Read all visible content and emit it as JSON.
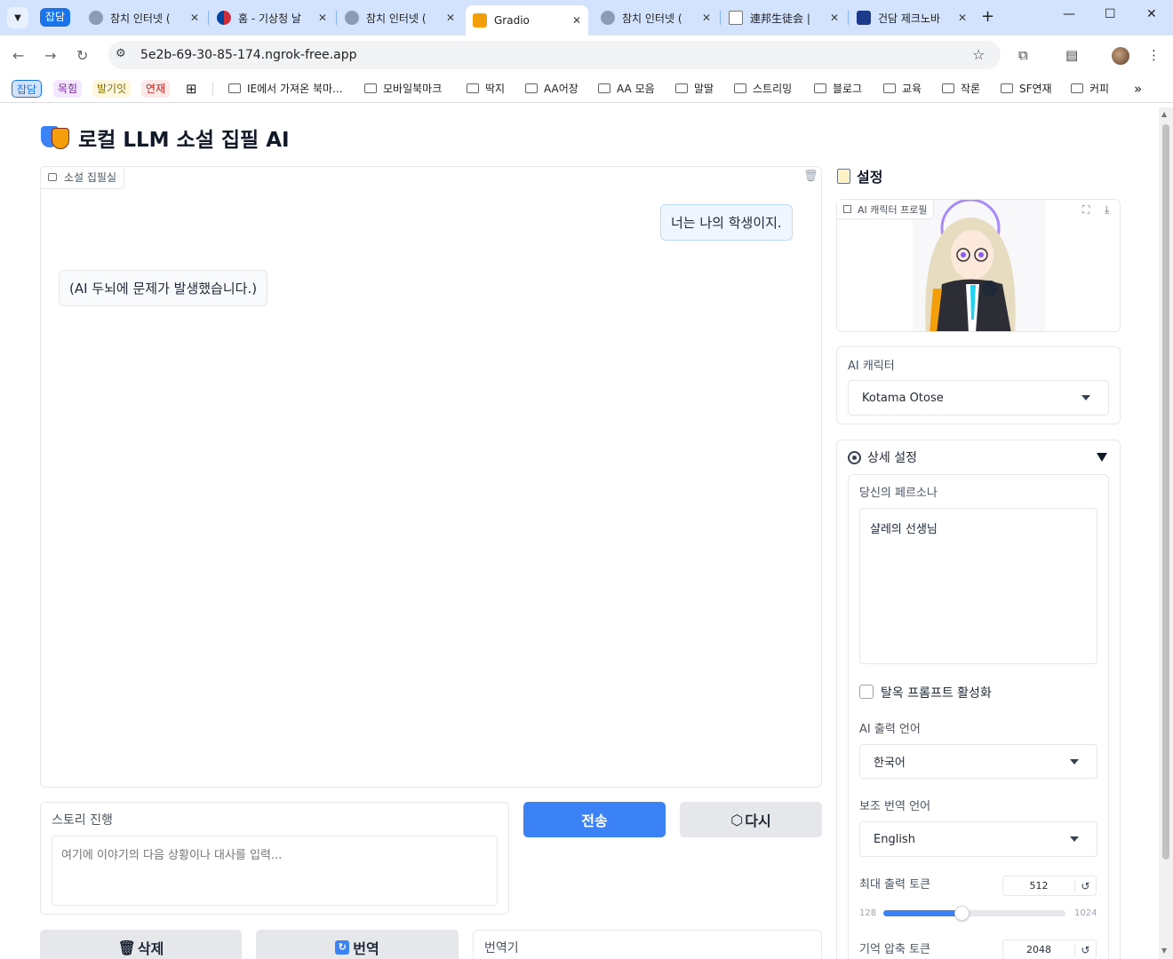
{
  "browser": {
    "tab_group_label": "잡담",
    "tabs": [
      {
        "title": "참치 인터넷 (",
        "active": false
      },
      {
        "title": "홈 - 기상청 날",
        "active": false
      },
      {
        "title": "참치 인터넷 (",
        "active": false
      },
      {
        "title": "Gradio",
        "active": true
      },
      {
        "title": "참치 인터넷 (",
        "active": false
      },
      {
        "title": "連邦生徒会 |",
        "active": false
      },
      {
        "title": "건담 제크노바",
        "active": false
      }
    ],
    "url": "5e2b-69-30-85-174.ngrok-free.app",
    "bookmark_chips": [
      "잡담",
      "목힘",
      "발기잇",
      "연재"
    ],
    "bookmark_folders": [
      "IE에서 가져온 북마...",
      "모바일북마크",
      "딱지",
      "AA어장",
      "AA 모음",
      "말딸",
      "스트리밍",
      "블로그",
      "교육",
      "작론",
      "SF연재",
      "커피"
    ]
  },
  "app": {
    "title": "로컬 LLM 소설 집필 AI",
    "chatbot_label": "소설 집필실",
    "messages": [
      {
        "role": "user",
        "text": "너는 나의 학생이지."
      },
      {
        "role": "bot",
        "text": "(AI 두뇌에 문제가 발생했습니다.)"
      }
    ],
    "story_label": "스토리 진행",
    "story_placeholder": "여기에 이야기의 다음 상황이나 대사를 입력...",
    "send_label": "전송",
    "retry_label": "다시",
    "delete_label": "삭제",
    "translate_label": "번역",
    "translator_label": "번역기"
  },
  "settings": {
    "title": "설정",
    "profile_label": "AI 캐릭터 프로필",
    "character_label": "AI 캐릭터",
    "character_value": "Kotama Otose",
    "advanced_label": "상세 설정",
    "persona_label": "당신의 페르소나",
    "persona_value": "샬레의 선생님",
    "jailbreak_label": "탈옥 프롬프트 활성화",
    "output_language_label": "AI 출력 언어",
    "output_language_value": "한국어",
    "translation_language_label": "보조 번역 언어",
    "translation_language_value": "English",
    "max_tokens_label": "최대 출력 토큰",
    "max_tokens_value": "512",
    "max_tokens_min": "128",
    "max_tokens_max": "1024",
    "memory_tokens_label": "기억 압축 토큰",
    "memory_tokens_value": "2048"
  },
  "colors": {
    "primary": "#3b82f6",
    "tab_strip": "#d3e3fd"
  }
}
